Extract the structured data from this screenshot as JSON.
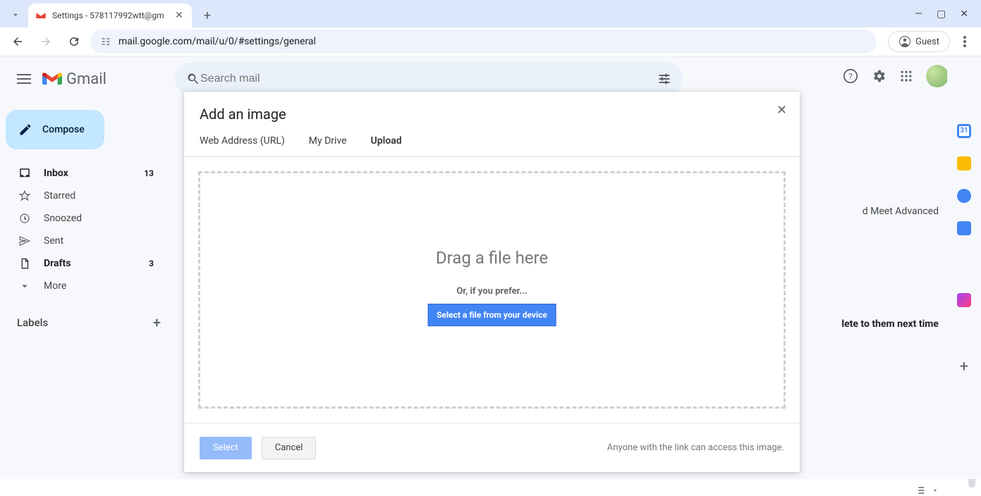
{
  "browser": {
    "tab_title": "Settings - 578117992wtt@gm",
    "url": "mail.google.com/mail/u/0/#settings/general",
    "guest_label": "Guest"
  },
  "gmail": {
    "product_name": "Gmail",
    "search_placeholder": "Search mail",
    "compose_label": "Compose",
    "nav": {
      "inbox": {
        "label": "Inbox",
        "count": "13"
      },
      "starred": {
        "label": "Starred"
      },
      "snoozed": {
        "label": "Snoozed"
      },
      "sent": {
        "label": "Sent"
      },
      "drafts": {
        "label": "Drafts",
        "count": "3"
      },
      "more": {
        "label": "More"
      }
    },
    "labels_header": "Labels",
    "bg_tabs_right": "d Meet    Advanced",
    "bg_text_right": "lete to them next time"
  },
  "dialog": {
    "title": "Add an image",
    "tabs": {
      "url": "Web Address (URL)",
      "drive": "My Drive",
      "upload": "Upload"
    },
    "dropzone": {
      "heading": "Drag a file here",
      "or": "Or, if you prefer...",
      "button": "Select a file from your device"
    },
    "footer": {
      "select": "Select",
      "cancel": "Cancel",
      "note": "Anyone with the link can access this image."
    }
  }
}
